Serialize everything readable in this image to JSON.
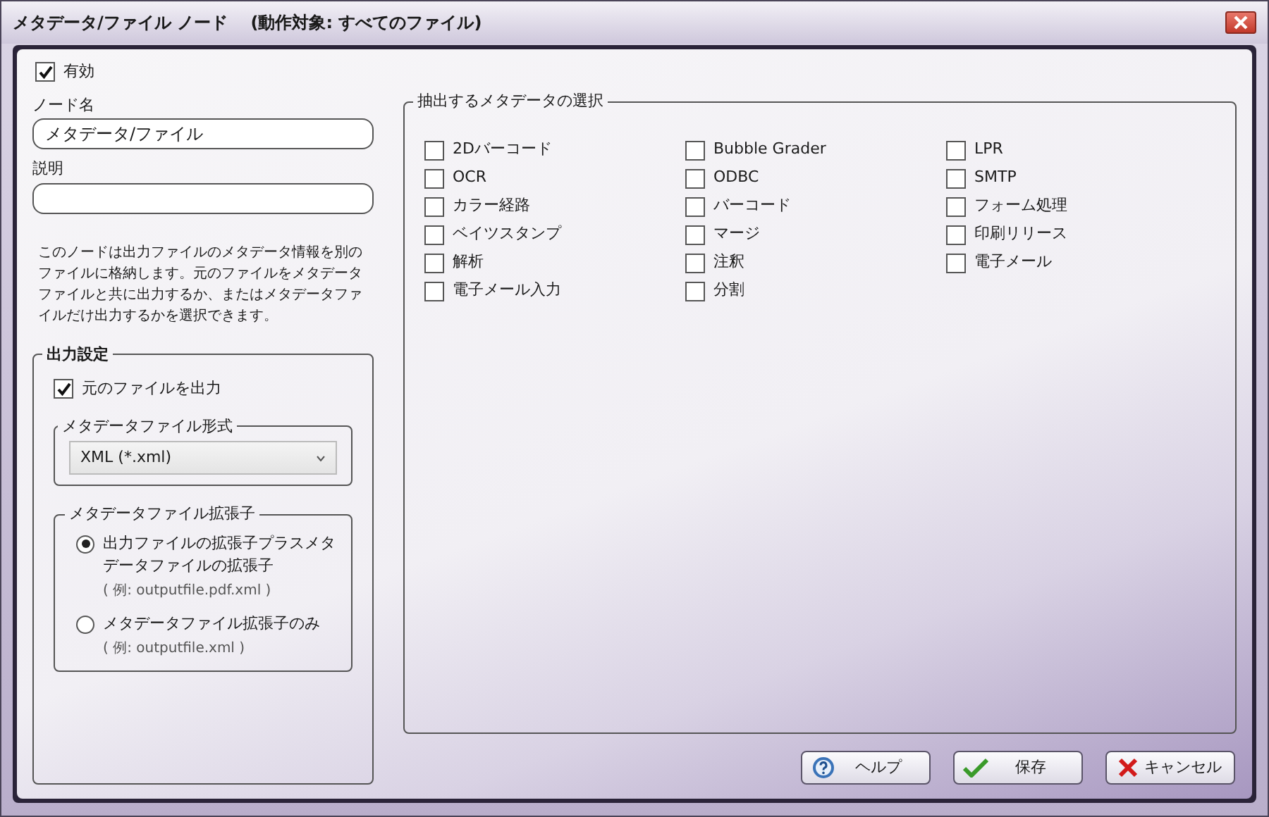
{
  "window": {
    "title": "メタデータ/ファイル ノード　 (動作対象: すべてのファイル)"
  },
  "enabled": {
    "label": "有効",
    "checked": true
  },
  "node_name": {
    "label": "ノード名",
    "value": "メタデータ/ファイル"
  },
  "description": {
    "label": "説明"
  },
  "info_text": "このノードは出力ファイルのメタデータ情報を別のファイルに格納します。元のファイルをメタデータファイルと共に出力するか、またはメタデータファイルだけ出力するかを選択できます。",
  "output_settings": {
    "legend": "出力設定",
    "output_original": {
      "label": "元のファイルを出力",
      "checked": true
    },
    "format": {
      "legend": "メタデータファイル形式",
      "value": "XML (*.xml)"
    },
    "extension": {
      "legend": "メタデータファイル拡張子",
      "options": [
        {
          "label": "出力ファイルの拡張子プラスメタデータファイルの拡張子",
          "example": "( 例: outputfile.pdf.xml )",
          "selected": true
        },
        {
          "label": "メタデータファイル拡張子のみ",
          "example": "( 例: outputfile.xml )",
          "selected": false
        }
      ]
    }
  },
  "metadata_selection": {
    "legend": "抽出するメタデータの選択",
    "columns": [
      [
        {
          "label": "2Dバーコード",
          "checked": false
        },
        {
          "label": "OCR",
          "checked": false
        },
        {
          "label": "カラー経路",
          "checked": false
        },
        {
          "label": "ベイツスタンプ",
          "checked": false
        },
        {
          "label": "解析",
          "checked": false
        },
        {
          "label": "電子メール入力",
          "checked": false
        }
      ],
      [
        {
          "label": "Bubble Grader",
          "checked": false
        },
        {
          "label": "ODBC",
          "checked": false
        },
        {
          "label": "バーコード",
          "checked": false
        },
        {
          "label": "マージ",
          "checked": false
        },
        {
          "label": "注釈",
          "checked": false
        },
        {
          "label": "分割",
          "checked": false
        }
      ],
      [
        {
          "label": "LPR",
          "checked": false
        },
        {
          "label": "SMTP",
          "checked": false
        },
        {
          "label": "フォーム処理",
          "checked": false
        },
        {
          "label": "印刷リリース",
          "checked": false
        },
        {
          "label": "電子メール",
          "checked": false
        }
      ]
    ]
  },
  "buttons": [
    {
      "label": "ヘルプ",
      "kind": "help"
    },
    {
      "label": "保存",
      "kind": "save"
    },
    {
      "label": "キャンセル",
      "kind": "cancel"
    }
  ]
}
